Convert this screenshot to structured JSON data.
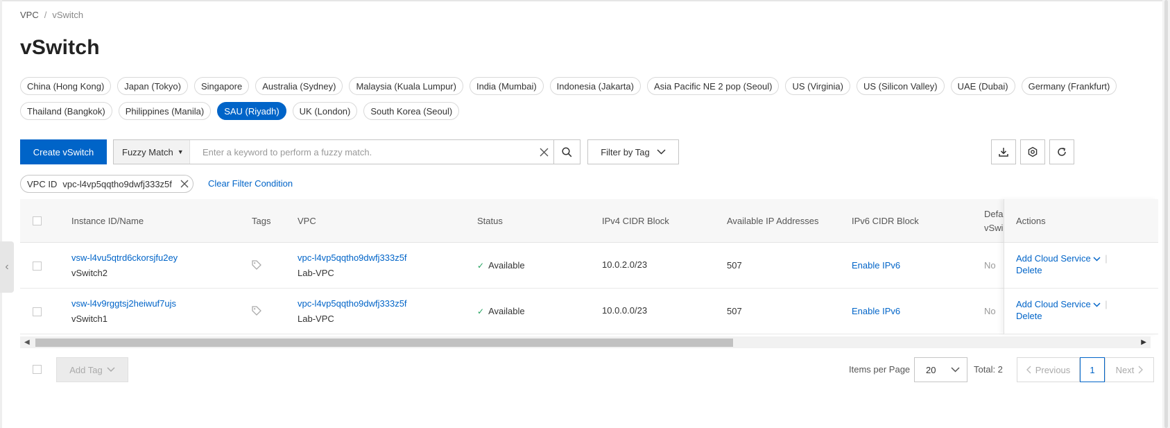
{
  "breadcrumb": {
    "root": "VPC",
    "separator": "/",
    "current": "vSwitch"
  },
  "page": {
    "title": "vSwitch"
  },
  "regions": {
    "row1": [
      "China (Hong Kong)",
      "Japan (Tokyo)",
      "Singapore",
      "Australia (Sydney)",
      "Malaysia (Kuala Lumpur)",
      "India (Mumbai)",
      "Indonesia (Jakarta)",
      "Asia Pacific NE 2 pop (Seoul)",
      "US (Virginia)",
      "US (Silicon Valley)",
      "UAE (Dubai)",
      "Germany (Frankfurt)"
    ],
    "row2": [
      "Thailand (Bangkok)",
      "Philippines (Manila)",
      "SAU (Riyadh)",
      "UK (London)",
      "South Korea (Seoul)"
    ],
    "selected": "SAU (Riyadh)"
  },
  "toolbar": {
    "create_label": "Create vSwitch",
    "match_mode": "Fuzzy Match",
    "search_placeholder": "Enter a keyword to perform a fuzzy match.",
    "search_value": "",
    "filter_tag_label": "Filter by Tag",
    "icons": [
      "download-icon",
      "settings-icon",
      "refresh-icon"
    ]
  },
  "filter": {
    "chip_key": "VPC ID",
    "chip_value": "vpc-l4vp5qqtho9dwfj333z5f",
    "clear_label": "Clear Filter Condition"
  },
  "table": {
    "headers": {
      "instance": "Instance ID/Name",
      "tags": "Tags",
      "vpc": "VPC",
      "status": "Status",
      "ipv4": "IPv4 CIDR Block",
      "available_ip": "Available IP Addresses",
      "ipv6": "IPv6 CIDR Block",
      "default_line1": "Defa",
      "default_line2": "vSwi",
      "actions": "Actions"
    },
    "rows": [
      {
        "id": "vsw-l4vu5qtrd6ckorsjfu2ey",
        "name": "vSwitch2",
        "vpc_id": "vpc-l4vp5qqtho9dwfj333z5f",
        "vpc_name": "Lab-VPC",
        "status": "Available",
        "ipv4": "10.0.2.0/23",
        "available_ip": "507",
        "ipv6": "Enable IPv6",
        "default": "No",
        "action_add": "Add Cloud Service",
        "action_delete": "Delete"
      },
      {
        "id": "vsw-l4v9rggtsj2heiwuf7ujs",
        "name": "vSwitch1",
        "vpc_id": "vpc-l4vp5qqtho9dwfj333z5f",
        "vpc_name": "Lab-VPC",
        "status": "Available",
        "ipv4": "10.0.0.0/23",
        "available_ip": "507",
        "ipv6": "Enable IPv6",
        "default": "No",
        "action_add": "Add Cloud Service",
        "action_delete": "Delete"
      }
    ]
  },
  "footer": {
    "add_tag_label": "Add Tag",
    "items_per_page_label": "Items per Page",
    "items_per_page": "20",
    "total_label": "Total: 2",
    "prev_label": "Previous",
    "current_page": "1",
    "next_label": "Next"
  },
  "colors": {
    "primary": "#0064c8",
    "success": "#23a25f",
    "border": "#c5c5c5"
  }
}
